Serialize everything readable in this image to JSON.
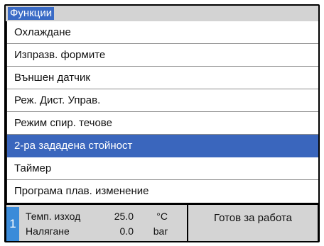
{
  "header": {
    "title": "Функции"
  },
  "menu": {
    "items": [
      {
        "label": "Охлаждане"
      },
      {
        "label": "Изпразв. формите"
      },
      {
        "label": "Външен датчик"
      },
      {
        "label": "Реж. Дист. Управ."
      },
      {
        "label": "Режим спир. течове"
      },
      {
        "label": "2-ра зададена стойност",
        "selected": true
      },
      {
        "label": "Таймер"
      },
      {
        "label": "Програма плав. изменение"
      }
    ]
  },
  "status": {
    "index": "1",
    "rows": [
      {
        "label": "Темп. изход",
        "value": "25.0",
        "unit": "°C"
      },
      {
        "label": "Налягане",
        "value": "0.0",
        "unit": "bar"
      }
    ],
    "state": "Готов за работа"
  },
  "colors": {
    "selection": "#3a66bd",
    "header_bar": "#d3d3d3",
    "status_index": "#3a8bd9"
  }
}
